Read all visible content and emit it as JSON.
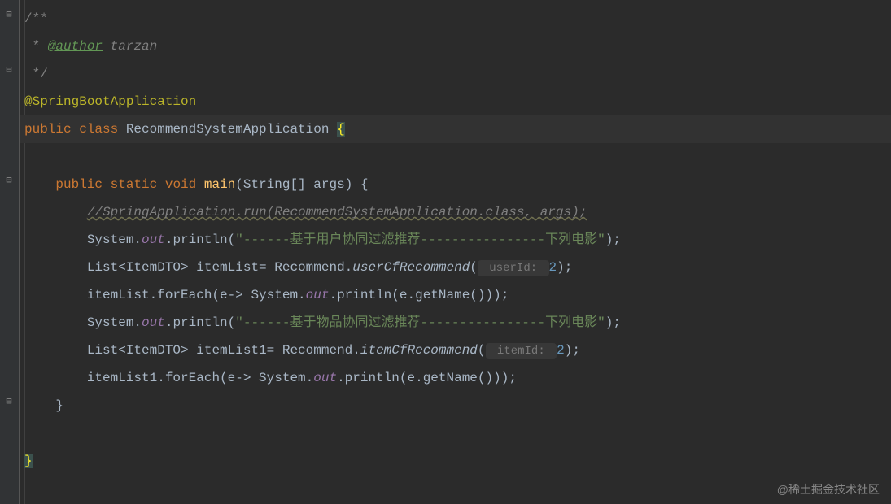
{
  "gutter": {
    "collapse_icon": "⊟",
    "expand_icon": "⊟"
  },
  "lines": {
    "l1": {
      "doc_open": "/**"
    },
    "l2": {
      "star": " * ",
      "tag": "@author",
      "value": " tarzan"
    },
    "l3": {
      "doc_close": " */"
    },
    "l4": {
      "annotation": "@SpringBootApplication"
    },
    "l5": {
      "kw_public": "public ",
      "kw_class": "class ",
      "class_name": "RecommendSystemApplication ",
      "brace": "{"
    },
    "l6": {
      "empty": ""
    },
    "l7": {
      "indent": "    ",
      "kw_public": "public ",
      "kw_static": "static ",
      "kw_void": "void ",
      "method": "main",
      "params": "(String[] args) {"
    },
    "l8": {
      "indent": "        ",
      "comment": "//SpringApplication.run(RecommendSystemApplication.class, args);"
    },
    "l9": {
      "indent": "        ",
      "sys": "System.",
      "out": "out",
      "print": ".println(",
      "str": "\"------基于用户协同过滤推荐----------------下列电影\"",
      "end": ");"
    },
    "l10": {
      "indent": "        ",
      "decl": "List<ItemDTO> itemList= Recommend.",
      "method_i": "userCfRecommend",
      "open": "(",
      "hint": " userId: ",
      "val": "2",
      "close": ");"
    },
    "l11": {
      "indent": "        ",
      "pre": "itemList.forEach(e-> System.",
      "out": "out",
      "rest": ".println(e.getName()));"
    },
    "l12": {
      "indent": "        ",
      "sys": "System.",
      "out": "out",
      "print": ".println(",
      "str": "\"------基于物品协同过滤推荐----------------下列电影\"",
      "end": ");"
    },
    "l13": {
      "indent": "        ",
      "decl": "List<ItemDTO> itemList1= Recommend.",
      "method_i": "itemCfRecommend",
      "open": "(",
      "hint": " itemId: ",
      "val": "2",
      "close": ");"
    },
    "l14": {
      "indent": "        ",
      "pre": "itemList1.forEach(e-> System.",
      "out": "out",
      "rest": ".println(e.getName()));"
    },
    "l15": {
      "indent": "    ",
      "brace": "}"
    },
    "l16": {
      "empty": ""
    },
    "l17": {
      "brace": "}"
    }
  },
  "watermark": "@稀土掘金技术社区"
}
